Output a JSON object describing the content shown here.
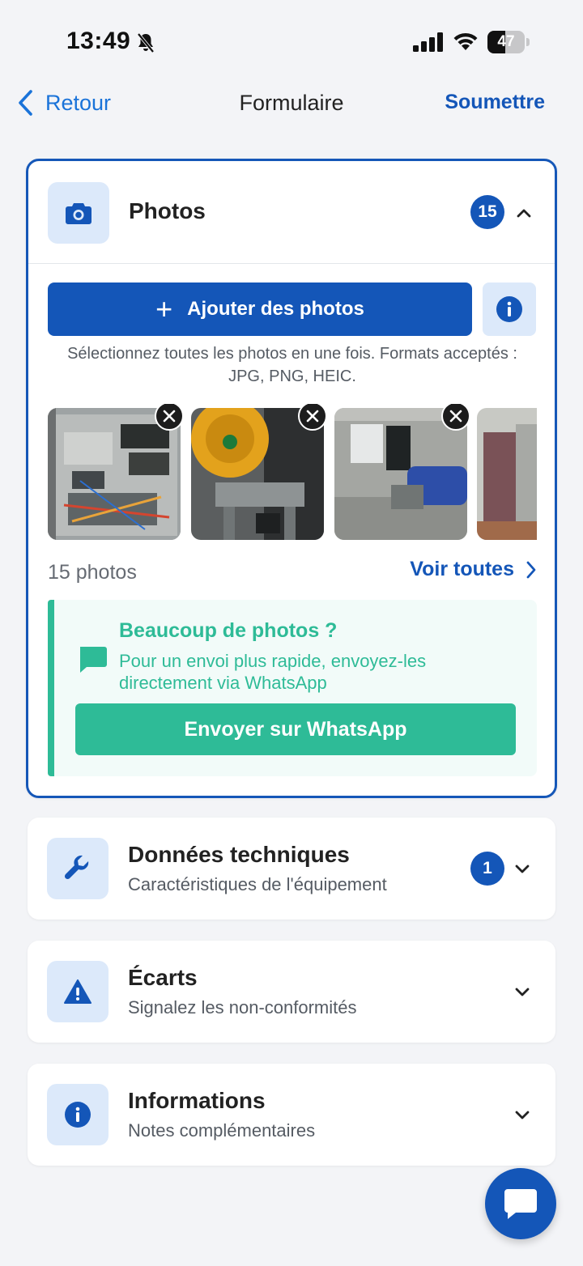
{
  "status": {
    "time": "13:49",
    "battery": "47",
    "battery_level": 0.47
  },
  "nav": {
    "back_label": "Retour",
    "title": "Formulaire",
    "submit_label": "Soumettre"
  },
  "photos_section": {
    "title": "Photos",
    "count_badge": "15",
    "add_button_label": "Ajouter des photos",
    "hint": "Sélectionnez toutes les photos en une fois. Formats acceptés : JPG, PNG, HEIC.",
    "photo_count_label": "15 photos",
    "see_all_label": "Voir toutes",
    "whatsapp": {
      "title": "Beaucoup de photos ?",
      "text": "Pour un envoi plus rapide, envoyez-les directement via WhatsApp",
      "button_label": "Envoyer sur WhatsApp"
    }
  },
  "sections": [
    {
      "title": "Données techniques",
      "subtitle": "Caractéristiques de l'équipement",
      "badge": "1",
      "icon": "wrench-icon"
    },
    {
      "title": "Écarts",
      "subtitle": "Signalez les non-conformités",
      "icon": "warning-icon"
    },
    {
      "title": "Informations",
      "subtitle": "Notes complémentaires",
      "icon": "info-icon"
    }
  ],
  "colors": {
    "primary": "#1456b8",
    "primary_light": "#dce9fa",
    "whatsapp": "#2ebb97",
    "link": "#1a73d9",
    "background": "#f3f4f7"
  }
}
